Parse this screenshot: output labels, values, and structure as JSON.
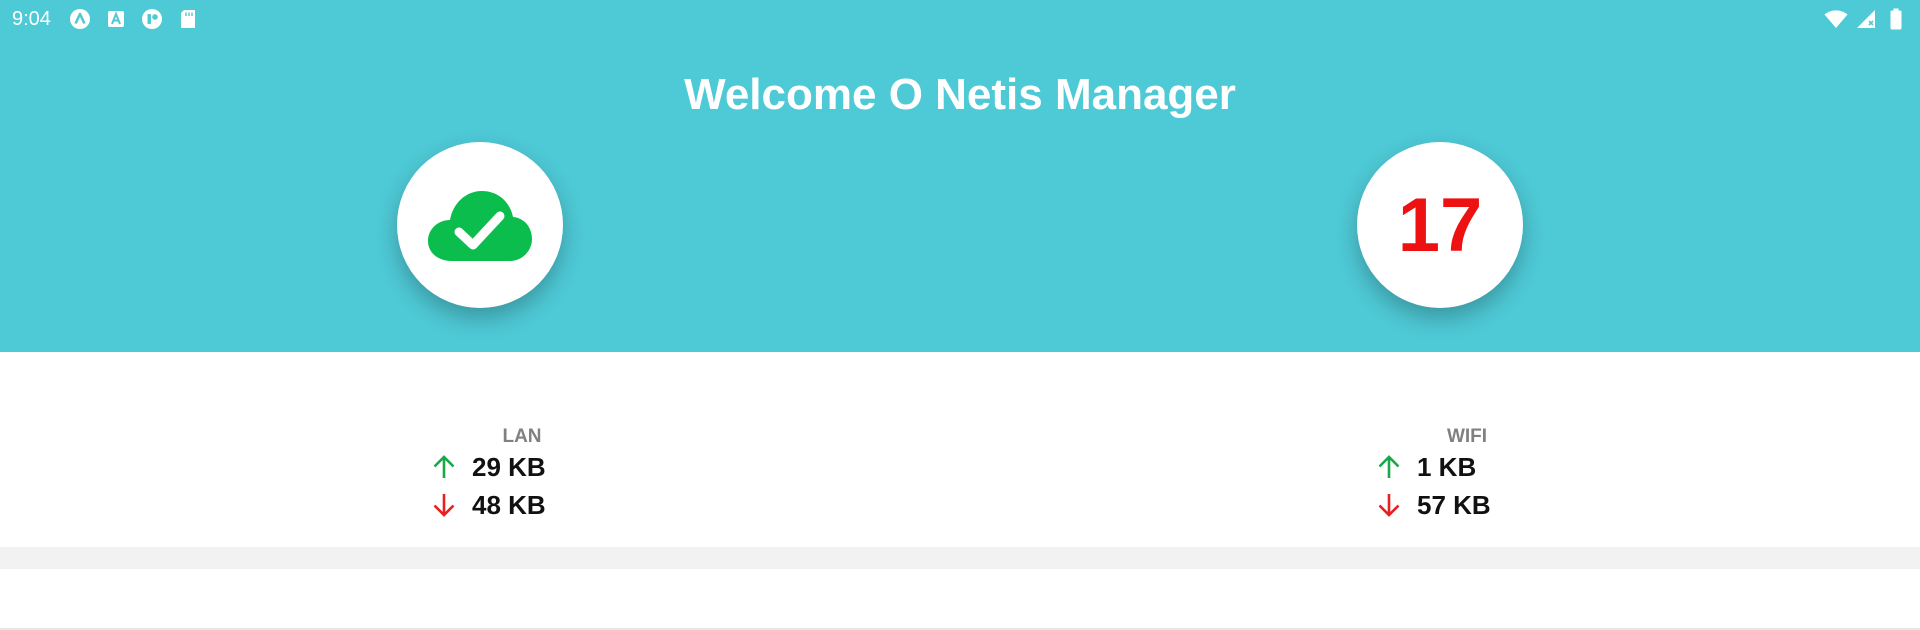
{
  "status_bar": {
    "time": "9:04",
    "left_icons": [
      "app-icon-a",
      "app-icon-square-a",
      "app-icon-pill",
      "sd-card-icon"
    ],
    "right_icons": [
      "wifi-icon",
      "signal-icon",
      "battery-icon"
    ]
  },
  "header": {
    "title": "Welcome O Netis Manager",
    "background_color": "#4ec9d6",
    "status_icon": "cloud-check-icon",
    "status_icon_color": "#0bbd4d",
    "device_count": "17",
    "device_count_color": "#ee1111"
  },
  "traffic": {
    "lan": {
      "label": "LAN",
      "upload": "29 KB",
      "download": "48 KB"
    },
    "wifi": {
      "label": "WIFI",
      "upload": "1 KB",
      "download": "57 KB"
    },
    "upload_color": "#18a84a",
    "download_color": "#e82020"
  }
}
